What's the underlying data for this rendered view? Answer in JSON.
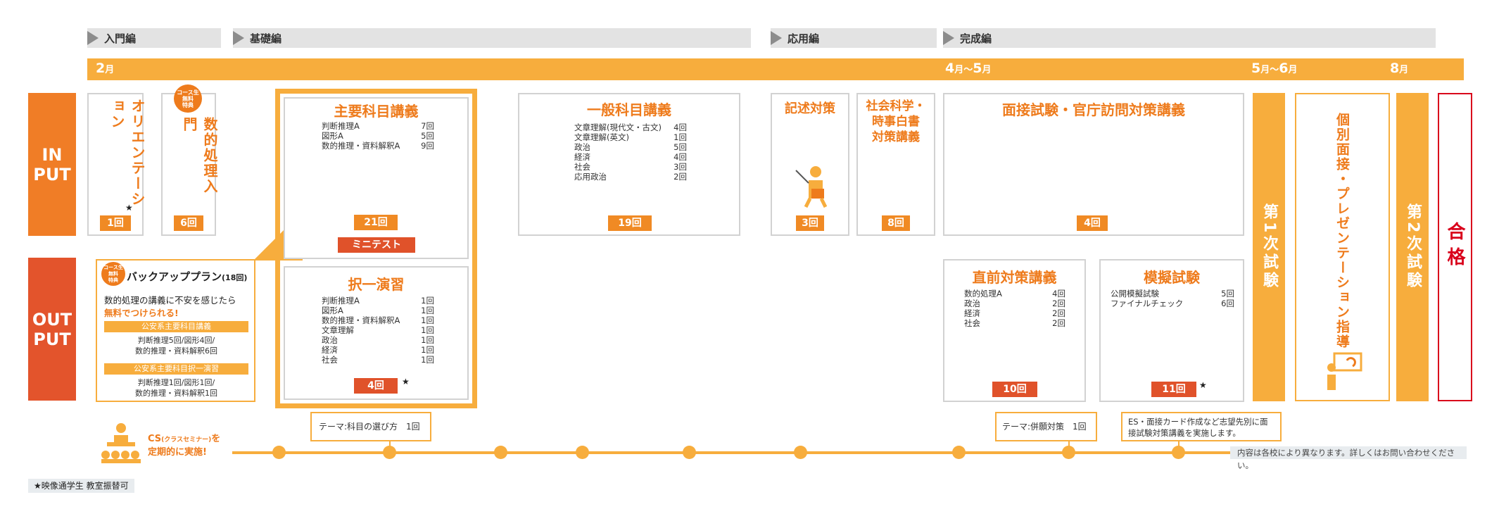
{
  "phases": [
    {
      "label": "入門編"
    },
    {
      "label": "基礎編"
    },
    {
      "label": "応用編"
    },
    {
      "label": "完成編"
    }
  ],
  "months": {
    "feb_num": "2",
    "feb_unit": "月",
    "apr_num": "4",
    "apr_unit": "月",
    "tilde1": "～",
    "may_num": "5",
    "may_unit": "月",
    "may2_num": "5",
    "may2_unit": "月",
    "tilde2": "～",
    "jun_num": "6",
    "jun_unit": "月",
    "aug_num": "8",
    "aug_unit": "月"
  },
  "side": {
    "input": "IN\nPUT",
    "output": "OUT\nPUT"
  },
  "orientation": {
    "title": "オリエンテーション",
    "star": "★",
    "count": "1回"
  },
  "suteki": {
    "badge": "コース生\n無料\n特典",
    "title": "数的処理入門",
    "count": "6回"
  },
  "main_lecture": {
    "title": "主要科目講義",
    "rows": [
      [
        "判断推理A",
        "7回"
      ],
      [
        "図形A",
        "5回"
      ],
      [
        "数的推理・資料解釈A",
        "9回"
      ]
    ],
    "count": "21回",
    "mini": "ミニテスト"
  },
  "general": {
    "title": "一般科目講義",
    "rows": [
      [
        "文章理解(現代文・古文)",
        "4回"
      ],
      [
        "文章理解(英文)",
        "1回"
      ],
      [
        "政治",
        "5回"
      ],
      [
        "経済",
        "4回"
      ],
      [
        "社会",
        "3回"
      ],
      [
        "応用政治",
        "2回"
      ]
    ],
    "count": "19回"
  },
  "kijutsu": {
    "title": "記述対策",
    "count": "3回"
  },
  "shakai": {
    "title": "社会科学・\n時事白書\n対策講義",
    "count": "8回"
  },
  "interview": {
    "title": "面接試験・官庁訪問対策講義",
    "count": "4回"
  },
  "exam1": {
    "label": "第1次試験"
  },
  "kobetsu": {
    "title": "個別面接・プレゼンテーション指導"
  },
  "exam2": {
    "label": "第2次試験"
  },
  "pass": {
    "label": "合格"
  },
  "backup": {
    "badge": "コース生\n無料\n特典",
    "title": "バックアッププラン",
    "title_count": "(18回)",
    "desc1": "数的処理の講義に不安を感じたら",
    "desc2": "無料でつけられる!",
    "bar1": "公安系主要科目講義",
    "text1a": "判断推理5回/図形4回/",
    "text1b": "数的推理・資料解釈6回",
    "bar2": "公安系主要科目択一演習",
    "text2a": "判断推理1回/図形1回/",
    "text2b": "数的推理・資料解釈1回"
  },
  "takuitsu": {
    "title": "択一演習",
    "rows": [
      [
        "判断推理A",
        "1回"
      ],
      [
        "図形A",
        "1回"
      ],
      [
        "数的推理・資料解釈A",
        "1回"
      ],
      [
        "文章理解",
        "1回"
      ],
      [
        "政治",
        "1回"
      ],
      [
        "経済",
        "1回"
      ],
      [
        "社会",
        "1回"
      ]
    ],
    "count": "4回",
    "star": "★"
  },
  "chokuzen": {
    "title": "直前対策講義",
    "rows": [
      [
        "数的処理A",
        "4回"
      ],
      [
        "政治",
        "2回"
      ],
      [
        "経済",
        "2回"
      ],
      [
        "社会",
        "2回"
      ]
    ],
    "count": "10回"
  },
  "mogi": {
    "title": "模擬試験",
    "rows": [
      [
        "公開模擬試験",
        "5回"
      ],
      [
        "ファイナルチェック",
        "6回"
      ]
    ],
    "count": "11回",
    "star": "★"
  },
  "cs": {
    "line1a": "CS",
    "line1b": "(クラスセミナー)",
    "line1c": "を",
    "line2": "定期的に実施!"
  },
  "callouts": {
    "c1": "テーマ:科目の選び方　1回",
    "c2": "テーマ:併願対策　1回",
    "c3a": "ES・面接カード作成など志望先別に面",
    "c3b": "接試験対策講義を実施します。"
  },
  "note_right": "内容は各校により異なります。詳しくはお問い合わせください。",
  "footnote": "★映像通学生 教室振替可",
  "colors": {
    "orange": "#f7ad3d",
    "deep_orange": "#ee7b1c",
    "red": "#e0522a",
    "pass_red": "#d9001b"
  }
}
